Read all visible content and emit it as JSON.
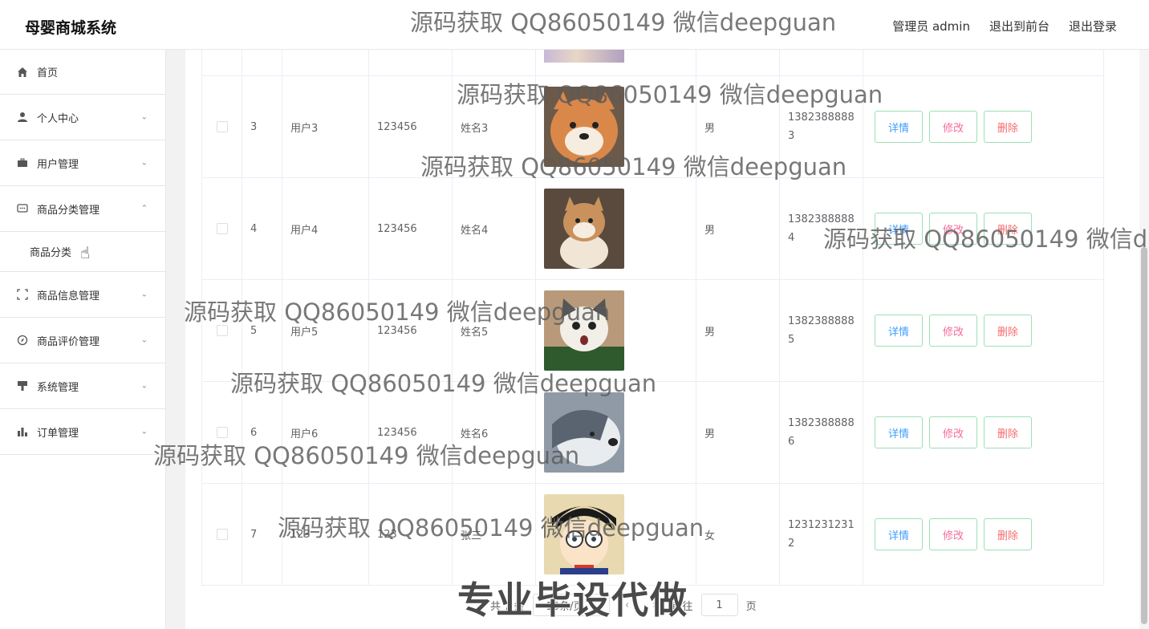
{
  "header": {
    "brand": "母婴商城系统",
    "admin_label": "管理员 admin",
    "to_front": "退出到前台",
    "logout": "退出登录"
  },
  "sidebar": {
    "items": [
      {
        "label": "首页",
        "icon": "home-icon",
        "chevron": ""
      },
      {
        "label": "个人中心",
        "icon": "user-icon",
        "chevron": "⌄"
      },
      {
        "label": "用户管理",
        "icon": "briefcase-icon",
        "chevron": "⌄"
      },
      {
        "label": "商品分类管理",
        "icon": "chat-icon",
        "chevron": "⌃"
      },
      {
        "label": "商品信息管理",
        "icon": "scan-icon",
        "chevron": "⌄"
      },
      {
        "label": "商品评价管理",
        "icon": "compass-icon",
        "chevron": "⌄"
      },
      {
        "label": "系统管理",
        "icon": "brush-icon",
        "chevron": "⌄"
      },
      {
        "label": "订单管理",
        "icon": "chart-icon",
        "chevron": "⌄"
      }
    ],
    "subitem": "商品分类"
  },
  "table": {
    "rows": [
      {
        "idx": "3",
        "user": "用户3",
        "pwd": "123456",
        "name": "姓名3",
        "sex": "男",
        "phone": "13823888883",
        "img_color": "#d9884a",
        "img_kind": "shiba-face"
      },
      {
        "idx": "4",
        "user": "用户4",
        "pwd": "123456",
        "name": "姓名4",
        "sex": "男",
        "phone": "13823888884",
        "img_color": "#c9925c",
        "img_kind": "shiba-sit"
      },
      {
        "idx": "5",
        "user": "用户5",
        "pwd": "123456",
        "name": "姓名5",
        "sex": "男",
        "phone": "13823888885",
        "img_color": "#8a7a6a",
        "img_kind": "cat"
      },
      {
        "idx": "6",
        "user": "用户6",
        "pwd": "123456",
        "name": "姓名6",
        "sex": "男",
        "phone": "13823888886",
        "img_color": "#8f9aa6",
        "img_kind": "husky"
      },
      {
        "idx": "7",
        "user": "123",
        "pwd": "123",
        "name": "张三",
        "sex": "女",
        "phone": "12312312312",
        "img_color": "#c89a4a",
        "img_kind": "cartoon"
      }
    ],
    "buttons": {
      "detail": "详情",
      "edit": "修改",
      "delete": "删除"
    }
  },
  "pagination": {
    "total_text": "共 7 条",
    "page_size": "10条/页",
    "goto_label": "前往",
    "page_value": "1",
    "page_suffix": "页"
  },
  "watermarks": {
    "text": "源码获取 QQ86050149 微信deepguan",
    "text_cut": "源码获取 QQ86050149 微信d",
    "stamp": "专业毕设代做"
  }
}
